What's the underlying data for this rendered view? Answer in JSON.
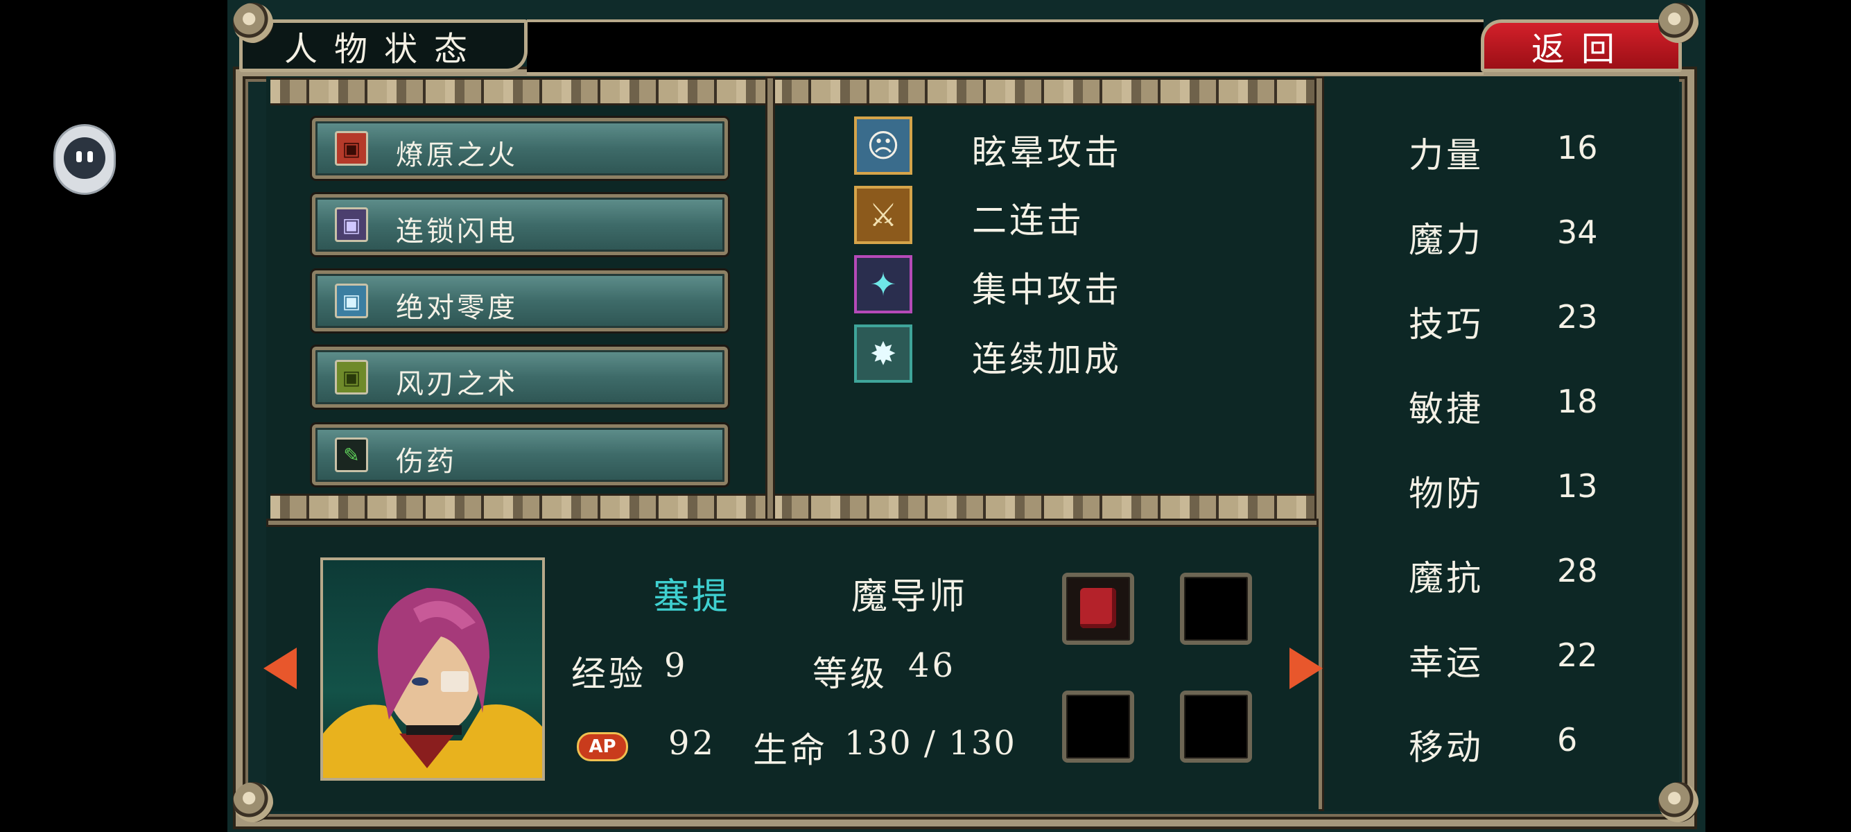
{
  "title": "人物状态",
  "return_label": "返回",
  "items": [
    {
      "label": "燎原之火",
      "icon": "fire-tome-icon",
      "color": "#b53a2a"
    },
    {
      "label": "连锁闪电",
      "icon": "lightning-tome-icon",
      "color": "#4b3f6e"
    },
    {
      "label": "绝对零度",
      "icon": "ice-tome-icon",
      "color": "#3b7ea1"
    },
    {
      "label": "风刃之术",
      "icon": "wind-tome-icon",
      "color": "#6f8a2a"
    },
    {
      "label": "伤药",
      "icon": "potion-icon",
      "color": "#3a8f3a"
    }
  ],
  "skills": [
    {
      "label": "眩晕攻击",
      "icon": "stun-attack-icon",
      "border": "#d5a44a"
    },
    {
      "label": "二连击",
      "icon": "double-strike-icon",
      "border": "#d5a44a"
    },
    {
      "label": "集中攻击",
      "icon": "focus-attack-icon",
      "border": "#b54ab8"
    },
    {
      "label": "连续加成",
      "icon": "combo-bonus-icon",
      "border": "#3fa59a"
    }
  ],
  "stats": [
    {
      "label": "力量",
      "value": "16"
    },
    {
      "label": "魔力",
      "value": "34"
    },
    {
      "label": "技巧",
      "value": "23"
    },
    {
      "label": "敏捷",
      "value": "18"
    },
    {
      "label": "物防",
      "value": "13"
    },
    {
      "label": "魔抗",
      "value": "28"
    },
    {
      "label": "幸运",
      "value": "22"
    },
    {
      "label": "移动",
      "value": "6"
    }
  ],
  "character": {
    "name": "塞提",
    "class": "魔导师",
    "exp_label": "经验",
    "exp_value": "9",
    "level_label": "等级",
    "level_value": "46",
    "ap_badge": "AP",
    "ap_value": "92",
    "hp_label": "生命",
    "hp_value": "130 / 130"
  },
  "colors": {
    "name": "#3fd0d0",
    "return_bg": "#c8161f",
    "panel": "#0d2725"
  }
}
